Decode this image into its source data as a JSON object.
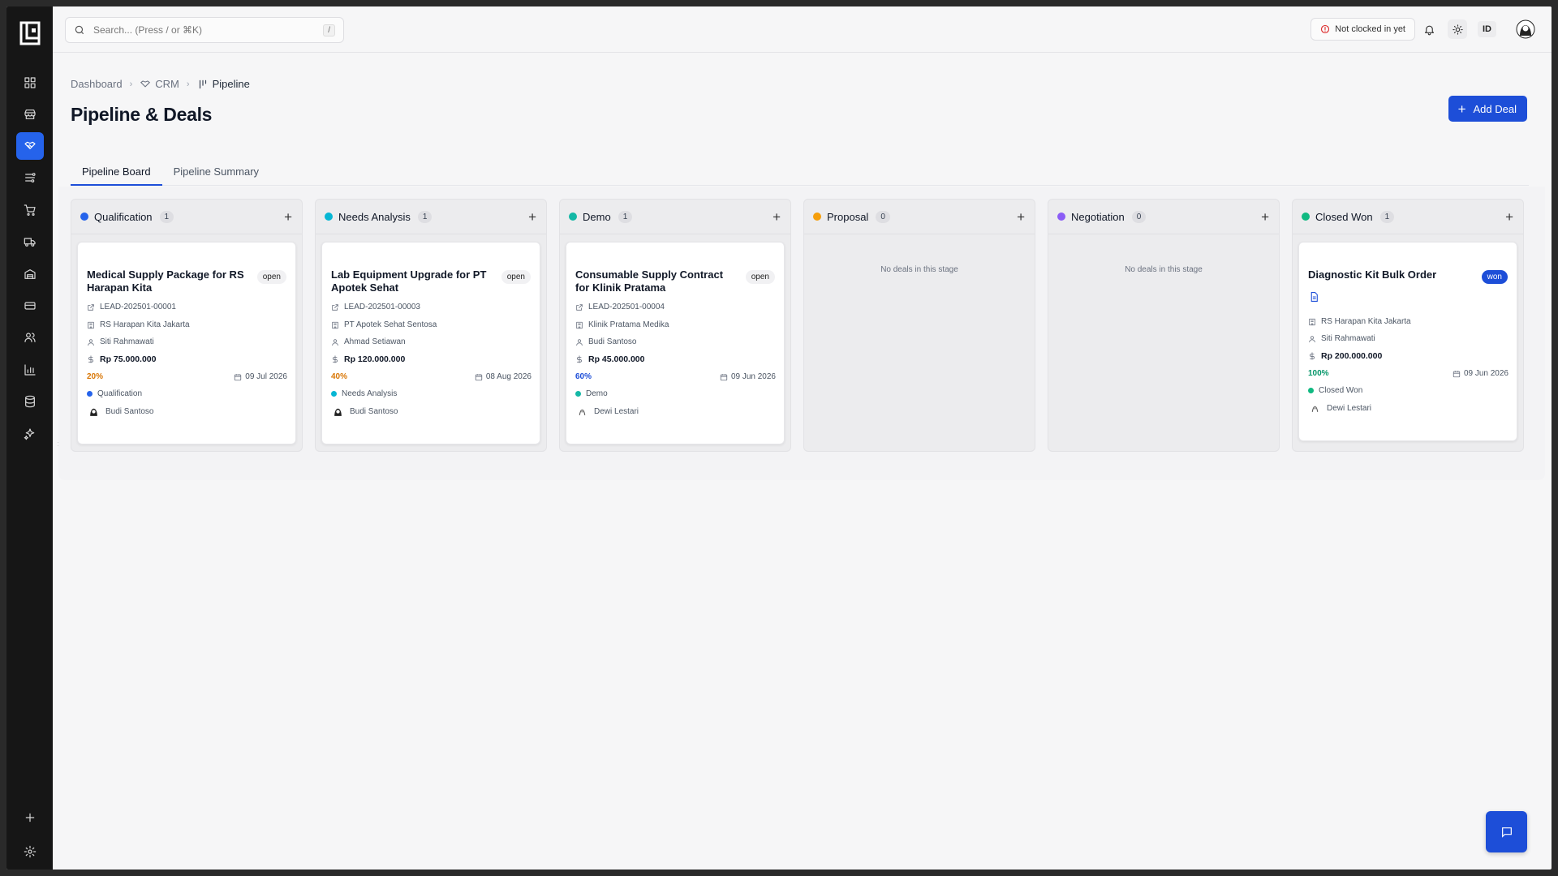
{
  "search": {
    "placeholder": "Search... (Press / or ⌘K)",
    "shortcut": "/"
  },
  "topbar": {
    "clock_status": "Not clocked in yet",
    "language": "ID"
  },
  "breadcrumb": {
    "items": [
      "Dashboard",
      "CRM",
      "Pipeline"
    ]
  },
  "page": {
    "title": "Pipeline & Deals",
    "add_button": "Add Deal"
  },
  "tabs": [
    {
      "label": "Pipeline Board",
      "active": true
    },
    {
      "label": "Pipeline Summary",
      "active": false
    }
  ],
  "sidebar": {
    "icons": [
      "dashboard-icon",
      "store-icon",
      "crm-handshake-icon",
      "pipeline-icon",
      "cart-icon",
      "truck-icon",
      "warehouse-icon",
      "card-icon",
      "users-icon",
      "chart-icon",
      "database-icon",
      "ai-sparkle-icon"
    ],
    "bottom_icons": [
      "plus-icon",
      "settings-icon"
    ],
    "active_index": 2
  },
  "colors": {
    "accent": "#1d4ed8",
    "sidebar_bg": "#161616",
    "page_bg": "#f6f6f7"
  },
  "columns": [
    {
      "title": "Qualification",
      "count": "1",
      "color": "#2563eb",
      "empty_text": "",
      "deal": {
        "title": "Medical Supply Package for RS Harapan Kita",
        "status": "open",
        "lead": "LEAD-202501-00001",
        "company": "RS Harapan Kita Jakarta",
        "contact": "Siti Rahmawati",
        "value": "Rp 75.000.000",
        "probability": "20%",
        "prob_color": "#d97706",
        "date": "09 Jul 2026",
        "stage": "Qualification",
        "stage_color": "#2563eb",
        "owner": "Budi Santoso"
      }
    },
    {
      "title": "Needs Analysis",
      "count": "1",
      "color": "#06b6d4",
      "empty_text": "",
      "deal": {
        "title": "Lab Equipment Upgrade for PT Apotek Sehat",
        "status": "open",
        "lead": "LEAD-202501-00003",
        "company": "PT Apotek Sehat Sentosa",
        "contact": "Ahmad Setiawan",
        "value": "Rp 120.000.000",
        "probability": "40%",
        "prob_color": "#d97706",
        "date": "08 Aug 2026",
        "stage": "Needs Analysis",
        "stage_color": "#06b6d4",
        "owner": "Budi Santoso"
      }
    },
    {
      "title": "Demo",
      "count": "1",
      "color": "#14b8a6",
      "empty_text": "",
      "deal": {
        "title": "Consumable Supply Contract for Klinik Pratama",
        "status": "open",
        "lead": "LEAD-202501-00004",
        "company": "Klinik Pratama Medika",
        "contact": "Budi Santoso",
        "value": "Rp 45.000.000",
        "probability": "60%",
        "prob_color": "#1d4ed8",
        "date": "09 Jun 2026",
        "stage": "Demo",
        "stage_color": "#14b8a6",
        "owner": "Dewi Lestari"
      }
    },
    {
      "title": "Proposal",
      "count": "0",
      "color": "#f59e0b",
      "empty_text": "No deals in this stage"
    },
    {
      "title": "Negotiation",
      "count": "0",
      "color": "#8b5cf6",
      "empty_text": "No deals in this stage"
    },
    {
      "title": "Closed Won",
      "count": "1",
      "color": "#10b981",
      "empty_text": "",
      "deal": {
        "title": "Diagnostic Kit Bulk Order",
        "status": "won",
        "lead": "",
        "company": "RS Harapan Kita Jakarta",
        "contact": "Siti Rahmawati",
        "value": "Rp 200.000.000",
        "probability": "100%",
        "prob_color": "#059669",
        "date": "09 Jun 2026",
        "stage": "Closed Won",
        "stage_color": "#10b981",
        "owner": "Dewi Lestari"
      }
    }
  ]
}
